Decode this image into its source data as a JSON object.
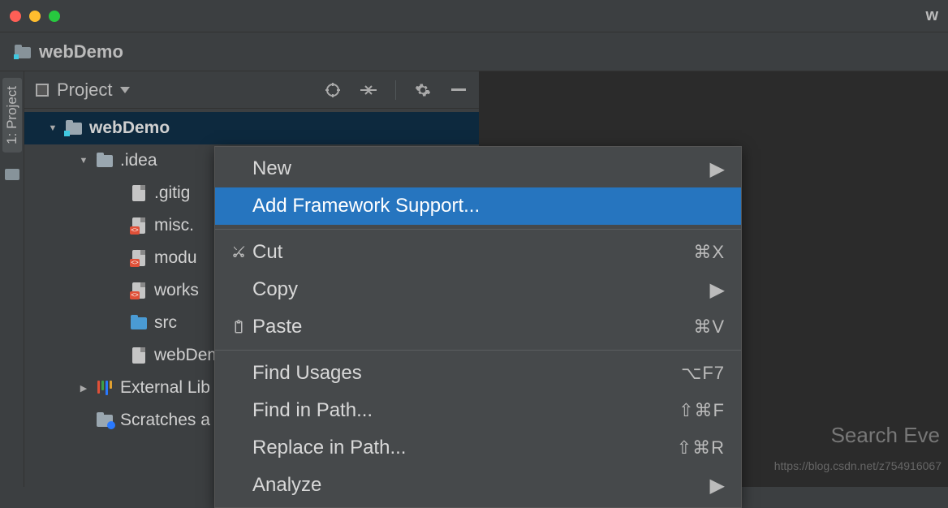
{
  "titlebar": {
    "partial_title": "w"
  },
  "breadcrumb": {
    "project_name": "webDemo"
  },
  "left_gutter": {
    "tool_label": "1: Project"
  },
  "project_panel": {
    "title": "Project",
    "tree": [
      {
        "name": "webDemo",
        "depth": 1,
        "icon": "module-folder",
        "open": true,
        "caret": "down",
        "bold": true,
        "selected": true
      },
      {
        "name": ".idea",
        "depth": 2,
        "icon": "folder",
        "open": true,
        "caret": "down"
      },
      {
        "name": ".gitig",
        "depth": 3,
        "icon": "file",
        "caret": "none"
      },
      {
        "name": "misc.",
        "depth": 3,
        "icon": "xml-file",
        "caret": "none"
      },
      {
        "name": "modu",
        "depth": 3,
        "icon": "xml-file",
        "caret": "none"
      },
      {
        "name": "works",
        "depth": 3,
        "icon": "xml-file",
        "caret": "none"
      },
      {
        "name": "src",
        "depth": 3,
        "icon": "blue-folder",
        "caret": "none"
      },
      {
        "name": "webDem",
        "depth": 3,
        "icon": "file",
        "caret": "none"
      },
      {
        "name": "External Lib",
        "depth": 2,
        "icon": "library",
        "caret": "right"
      },
      {
        "name": "Scratches a",
        "depth": 2,
        "icon": "scratch",
        "caret": "none"
      }
    ]
  },
  "context_menu": {
    "items": [
      {
        "label": "New",
        "submenu": true
      },
      {
        "label": "Add Framework Support...",
        "highlighted": true
      },
      {
        "sep": true
      },
      {
        "label": "Cut",
        "icon": "cut",
        "shortcut": "⌘X"
      },
      {
        "label": "Copy",
        "submenu": true
      },
      {
        "label": "Paste",
        "icon": "paste",
        "shortcut": "⌘V"
      },
      {
        "sep": true
      },
      {
        "label": "Find Usages",
        "shortcut": "⌥F7"
      },
      {
        "label": "Find in Path...",
        "shortcut": "⇧⌘F"
      },
      {
        "label": "Replace in Path...",
        "shortcut": "⇧⌘R"
      },
      {
        "label": "Analyze",
        "submenu": true
      }
    ]
  },
  "editor": {
    "search_hint": "Search Eve",
    "watermark_url": "https://blog.csdn.net/z754916067"
  }
}
